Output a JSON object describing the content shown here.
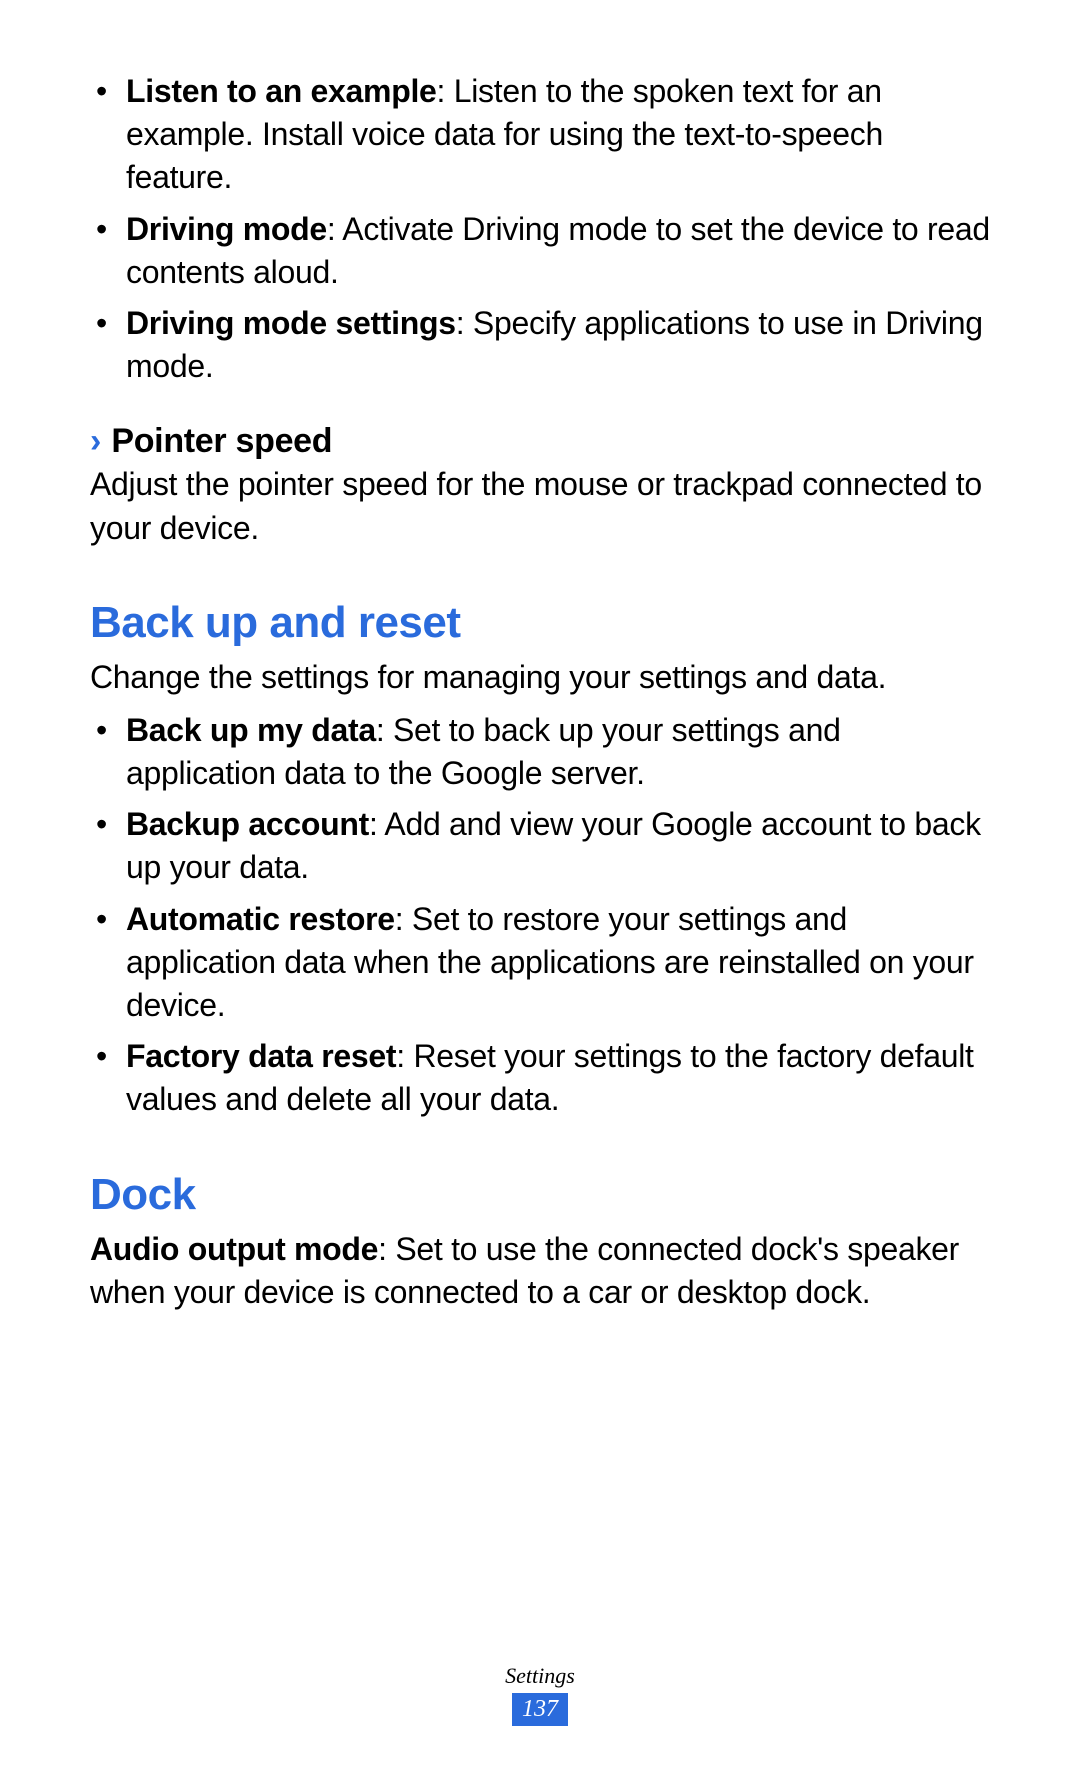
{
  "topBullets": [
    {
      "label": "Listen to an example",
      "text": ": Listen to the spoken text for an example. Install voice data for using the text-to-speech feature."
    },
    {
      "label": "Driving mode",
      "text": ": Activate Driving mode to set the device to read contents aloud."
    },
    {
      "label": "Driving mode settings",
      "text": ": Specify applications to use in Driving mode."
    }
  ],
  "pointerSpeed": {
    "heading": "Pointer speed",
    "body": "Adjust the pointer speed for the mouse or trackpad connected to your device."
  },
  "backupReset": {
    "heading": "Back up and reset",
    "intro": "Change the settings for managing your settings and data.",
    "bullets": [
      {
        "label": "Back up my data",
        "text": ": Set to back up your settings and application data to the Google server."
      },
      {
        "label": "Backup account",
        "text": ": Add and view your Google account to back up your data."
      },
      {
        "label": "Automatic restore",
        "text": ": Set to restore your settings and application data when the applications are reinstalled on your device."
      },
      {
        "label": "Factory data reset",
        "text": ": Reset your settings to the factory default values and delete all your data."
      }
    ]
  },
  "dock": {
    "heading": "Dock",
    "label": "Audio output mode",
    "text": ": Set to use the connected dock's speaker when your device is connected to a car or desktop dock."
  },
  "footer": {
    "section": "Settings",
    "page": "137"
  }
}
